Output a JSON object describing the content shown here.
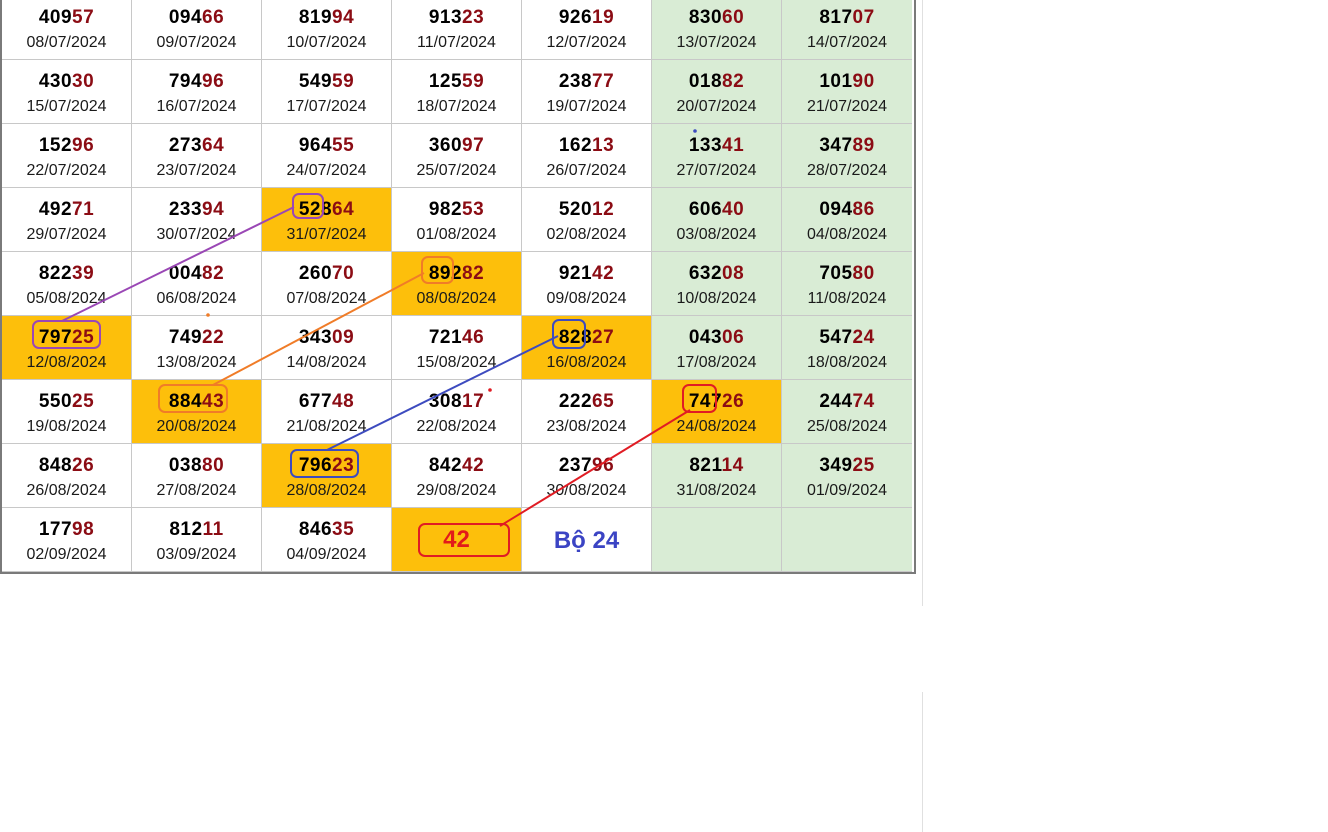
{
  "rows": [
    [
      {
        "lead": "409",
        "tail": "57",
        "date": "08/07/2024"
      },
      {
        "lead": "094",
        "tail": "66",
        "date": "09/07/2024"
      },
      {
        "lead": "819",
        "tail": "94",
        "date": "10/07/2024"
      },
      {
        "lead": "913",
        "tail": "23",
        "date": "11/07/2024"
      },
      {
        "lead": "926",
        "tail": "19",
        "date": "12/07/2024"
      },
      {
        "lead": "830",
        "tail": "60",
        "date": "13/07/2024"
      },
      {
        "lead": "817",
        "tail": "07",
        "date": "14/07/2024"
      }
    ],
    [
      {
        "lead": "430",
        "tail": "30",
        "date": "15/07/2024"
      },
      {
        "lead": "794",
        "tail": "96",
        "date": "16/07/2024"
      },
      {
        "lead": "549",
        "tail": "59",
        "date": "17/07/2024"
      },
      {
        "lead": "125",
        "tail": "59",
        "date": "18/07/2024"
      },
      {
        "lead": "238",
        "tail": "77",
        "date": "19/07/2024"
      },
      {
        "lead": "018",
        "tail": "82",
        "date": "20/07/2024"
      },
      {
        "lead": "101",
        "tail": "90",
        "date": "21/07/2024"
      }
    ],
    [
      {
        "lead": "152",
        "tail": "96",
        "date": "22/07/2024"
      },
      {
        "lead": "273",
        "tail": "64",
        "date": "23/07/2024"
      },
      {
        "lead": "964",
        "tail": "55",
        "date": "24/07/2024"
      },
      {
        "lead": "360",
        "tail": "97",
        "date": "25/07/2024"
      },
      {
        "lead": "162",
        "tail": "13",
        "date": "26/07/2024"
      },
      {
        "lead": "133",
        "tail": "41",
        "date": "27/07/2024"
      },
      {
        "lead": "347",
        "tail": "89",
        "date": "28/07/2024"
      }
    ],
    [
      {
        "lead": "492",
        "tail": "71",
        "date": "29/07/2024"
      },
      {
        "lead": "233",
        "tail": "94",
        "date": "30/07/2024"
      },
      {
        "lead": "528",
        "tail": "64",
        "date": "31/07/2024",
        "hl": true
      },
      {
        "lead": "982",
        "tail": "53",
        "date": "01/08/2024"
      },
      {
        "lead": "520",
        "tail": "12",
        "date": "02/08/2024"
      },
      {
        "lead": "606",
        "tail": "40",
        "date": "03/08/2024"
      },
      {
        "lead": "094",
        "tail": "86",
        "date": "04/08/2024"
      }
    ],
    [
      {
        "lead": "822",
        "tail": "39",
        "date": "05/08/2024"
      },
      {
        "lead": "004",
        "tail": "82",
        "date": "06/08/2024"
      },
      {
        "lead": "260",
        "tail": "70",
        "date": "07/08/2024"
      },
      {
        "lead": "892",
        "tail": "82",
        "date": "08/08/2024",
        "hl": true
      },
      {
        "lead": "921",
        "tail": "42",
        "date": "09/08/2024"
      },
      {
        "lead": "632",
        "tail": "08",
        "date": "10/08/2024"
      },
      {
        "lead": "705",
        "tail": "80",
        "date": "11/08/2024"
      }
    ],
    [
      {
        "lead": "797",
        "tail": "25",
        "date": "12/08/2024",
        "hl": true
      },
      {
        "lead": "749",
        "tail": "22",
        "date": "13/08/2024"
      },
      {
        "lead": "343",
        "tail": "09",
        "date": "14/08/2024"
      },
      {
        "lead": "721",
        "tail": "46",
        "date": "15/08/2024"
      },
      {
        "lead": "828",
        "tail": "27",
        "date": "16/08/2024",
        "hl": true
      },
      {
        "lead": "043",
        "tail": "06",
        "date": "17/08/2024"
      },
      {
        "lead": "547",
        "tail": "24",
        "date": "18/08/2024"
      }
    ],
    [
      {
        "lead": "550",
        "tail": "25",
        "date": "19/08/2024"
      },
      {
        "lead": "884",
        "tail": "43",
        "date": "20/08/2024",
        "hl": true
      },
      {
        "lead": "677",
        "tail": "48",
        "date": "21/08/2024"
      },
      {
        "lead": "308",
        "tail": "17",
        "date": "22/08/2024"
      },
      {
        "lead": "222",
        "tail": "65",
        "date": "23/08/2024"
      },
      {
        "lead": "747",
        "tail": "26",
        "date": "24/08/2024",
        "hl": true
      },
      {
        "lead": "244",
        "tail": "74",
        "date": "25/08/2024"
      }
    ],
    [
      {
        "lead": "848",
        "tail": "26",
        "date": "26/08/2024"
      },
      {
        "lead": "038",
        "tail": "80",
        "date": "27/08/2024"
      },
      {
        "lead": "796",
        "tail": "23",
        "date": "28/08/2024",
        "hl": true
      },
      {
        "lead": "842",
        "tail": "42",
        "date": "29/08/2024"
      },
      {
        "lead": "237",
        "tail": "96",
        "date": "30/08/2024"
      },
      {
        "lead": "821",
        "tail": "14",
        "date": "31/08/2024"
      },
      {
        "lead": "349",
        "tail": "25",
        "date": "01/09/2024"
      }
    ],
    [
      {
        "lead": "177",
        "tail": "98",
        "date": "02/09/2024"
      },
      {
        "lead": "812",
        "tail": "11",
        "date": "03/09/2024"
      },
      {
        "lead": "846",
        "tail": "35",
        "date": "04/09/2024"
      },
      {
        "special": "prediction",
        "value": "42",
        "hl": true
      },
      {
        "special": "label",
        "value": "Bộ 24"
      },
      {
        "special": "empty"
      },
      {
        "special": "empty"
      }
    ]
  ],
  "annotation_colors": {
    "purple": "#9a47b5",
    "orange": "#f07c28",
    "blue": "#3d4bbf",
    "red": "#e01c24"
  }
}
